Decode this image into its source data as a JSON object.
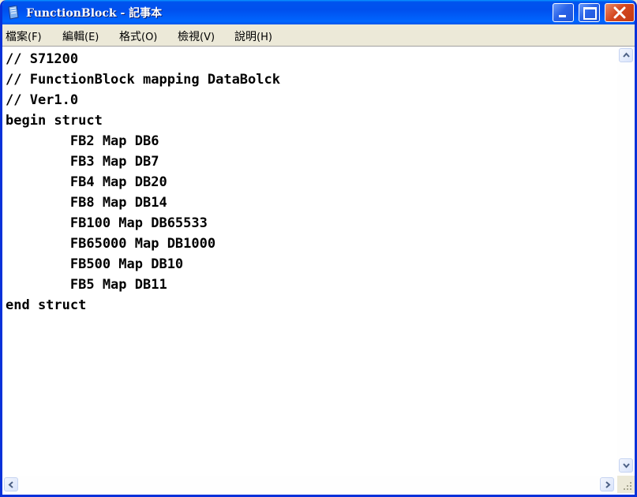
{
  "window": {
    "title": "FunctionBlock - 記事本",
    "colors": {
      "titlebar": "#0054e3",
      "close": "#d4471f",
      "editor_bg": "#ffffff"
    }
  },
  "menu": {
    "items": [
      {
        "label": "檔案",
        "accel": "(F)"
      },
      {
        "label": "編輯",
        "accel": "(E)"
      },
      {
        "label": "格式",
        "accel": "(O)"
      },
      {
        "label": "檢視",
        "accel": "(V)"
      },
      {
        "label": "說明",
        "accel": "(H)"
      }
    ]
  },
  "editor": {
    "content": "// S71200\n// FunctionBlock mapping DataBolck\n// Ver1.0\nbegin struct\n        FB2 Map DB6\n        FB3 Map DB7\n        FB4 Map DB20\n        FB8 Map DB14\n        FB100 Map DB65533\n        FB65000 Map DB1000\n        FB500 Map DB10\n        FB5 Map DB11\nend struct"
  },
  "icons": {
    "app": "notepad-icon",
    "minimize": "minimize-icon",
    "maximize": "maximize-icon",
    "close": "close-icon"
  }
}
